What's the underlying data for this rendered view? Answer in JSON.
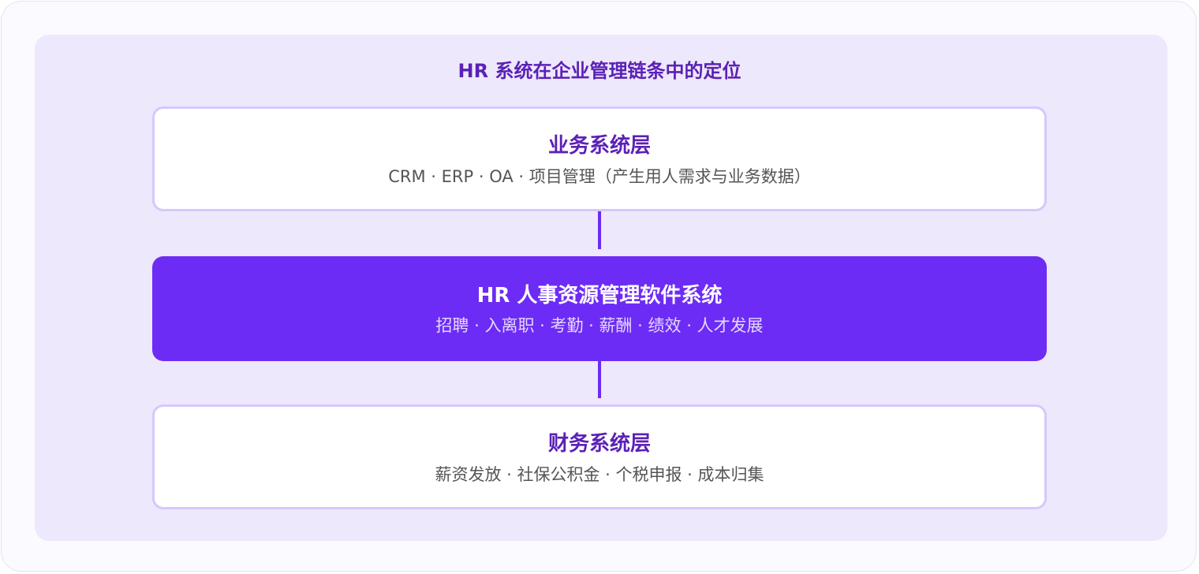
{
  "diagram": {
    "title": "HR 系统在企业管理链条中的定位",
    "layers": [
      {
        "title": "业务系统层",
        "subtitle": "CRM · ERP · OA · 项目管理（产生用人需求与业务数据）"
      },
      {
        "title": "HR 人事资源管理软件系统",
        "subtitle": "招聘 · 入离职 · 考勤 · 薪酬 · 绩效 · 人才发展"
      },
      {
        "title": "财务系统层",
        "subtitle": "薪资发放 · 社保公积金 · 个税申报 · 成本归集"
      }
    ]
  },
  "colors": {
    "accent": "#6d2cf5",
    "title_text": "#5b21b6",
    "panel_background": "#ede8fb",
    "box_border": "#d6c8fb"
  }
}
